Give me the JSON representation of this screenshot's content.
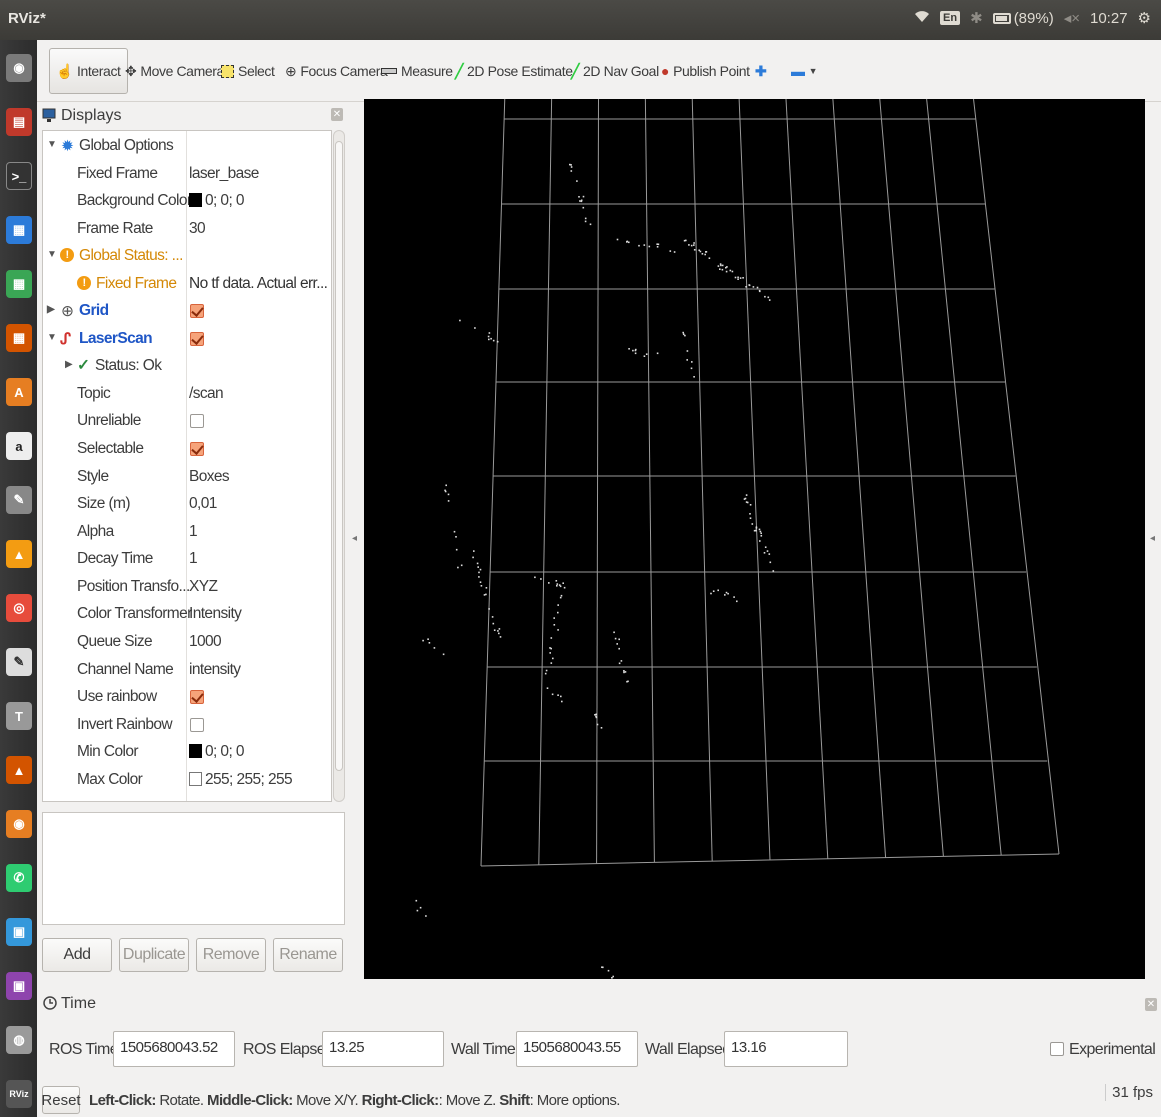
{
  "window": {
    "title": "RViz*"
  },
  "tray": {
    "keyboard": "En",
    "battery": "(89%)",
    "time": "10:27"
  },
  "toolbar": {
    "interact": "Interact",
    "move_camera": "Move Camera",
    "select": "Select",
    "focus_camera": "Focus Camera",
    "measure": "Measure",
    "pose_estimate": "2D Pose Estimate",
    "nav_goal": "2D Nav Goal",
    "publish_point": "Publish Point"
  },
  "displays": {
    "title": "Displays",
    "rows": {
      "global_options": "Global Options",
      "fixed_frame_label": "Fixed Frame",
      "fixed_frame_value": "laser_base",
      "bg_color_label": "Background Color",
      "bg_color_value": "0; 0; 0",
      "frame_rate_label": "Frame Rate",
      "frame_rate_value": "30",
      "global_status": "Global Status: ...",
      "status_fixed_frame": "Fixed Frame",
      "status_fixed_frame_value": "No tf data.  Actual err...",
      "grid": "Grid",
      "laserscan": "LaserScan",
      "status_ok": "Status: Ok",
      "topic_label": "Topic",
      "topic_value": "/scan",
      "unreliable_label": "Unreliable",
      "selectable_label": "Selectable",
      "style_label": "Style",
      "style_value": "Boxes",
      "size_label": "Size (m)",
      "size_value": "0,01",
      "alpha_label": "Alpha",
      "alpha_value": "1",
      "decay_label": "Decay Time",
      "decay_value": "1",
      "pos_label": "Position Transfo...",
      "pos_value": "XYZ",
      "color_tr_label": "Color Transformer",
      "color_tr_value": "Intensity",
      "queue_label": "Queue Size",
      "queue_value": "1000",
      "channel_label": "Channel Name",
      "channel_value": "intensity",
      "rainbow_label": "Use rainbow",
      "invert_label": "Invert Rainbow",
      "min_color_label": "Min Color",
      "min_color_value": "0; 0; 0",
      "max_color_label": "Max Color",
      "max_color_value": "255; 255; 255"
    },
    "buttons": {
      "add": "Add",
      "duplicate": "Duplicate",
      "remove": "Remove",
      "rename": "Rename"
    }
  },
  "time_panel": {
    "title": "Time",
    "ros_time_label": "ROS Time:",
    "ros_time_value": "1505680043.52",
    "ros_elapsed_label": "ROS Elapsed:",
    "ros_elapsed_value": "13.25",
    "wall_time_label": "Wall Time:",
    "wall_time_value": "1505680043.55",
    "wall_elapsed_label": "Wall Elapsed:",
    "wall_elapsed_value": "13.16",
    "experimental_label": "Experimental"
  },
  "statusbar": {
    "reset": "Reset",
    "left_click": "Left-Click:",
    "left_text": " Rotate. ",
    "middle_click": "Middle-Click:",
    "middle_text": " Move X/Y. ",
    "right_click": "Right-Click:",
    "right_text": ": Move Z. ",
    "shift": "Shift",
    "shift_text": ": More options.",
    "fps": "31 fps"
  },
  "colors": {
    "accent": "#e95420",
    "viewport_bg": "#000000",
    "grid": "#a0a0a0",
    "warning": "#f39c12",
    "link_blue": "#1f56c6"
  }
}
